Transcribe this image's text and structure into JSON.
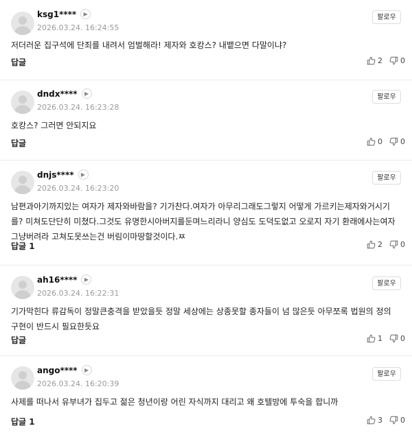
{
  "follow_label": "팔로우",
  "reply_label": "답글",
  "comments": [
    {
      "nickname": "ksg1****",
      "date": "2026.03.24. 16:24:55",
      "text": "저더러운 집구석에 단죄를 내려서 엄벌해라! 제자와 호캉스? 내뱉으면 다말이냐?",
      "reply": "답글",
      "likes": "2",
      "dislikes": "0"
    },
    {
      "nickname": "dndx****",
      "date": "2026.03.24. 16:23:28",
      "text": "호캉스? 그러면 안되지요",
      "reply": "답글",
      "likes": "0",
      "dislikes": "0"
    },
    {
      "nickname": "dnjs****",
      "date": "2026.03.24. 16:23:20",
      "text": "남편과아기까지있는 여자가 제자와바람을? 기가찬다.여자가 아무리그래도그렇지 어떻게 가르키는제자와거시기를? 미쳐도단단히 미쳤다.그것도 유명한시아버지를둔며느리라니 양심도 도덕도없고 오로지 자기 환래에사는여자 그냥버려라 고쳐도못쓰는건 버림이마땅할것이다.ㅉ",
      "reply": "답글 1",
      "likes": "2",
      "dislikes": "0"
    },
    {
      "nickname": "ah16****",
      "date": "2026.03.24. 16:22:31",
      "text": "기가막힌다 류감독이 정말큰충격을 받았을듯 정말 세상에는 상종못할 종자들이 넘 많은듯 아무쪼록 법원의 정의구현이 반드시 필요한듯요",
      "reply": "답글",
      "likes": "1",
      "dislikes": "0"
    },
    {
      "nickname": "ango****",
      "date": "2026.03.24. 16:20:39",
      "text": "사제를 떠나서 유부녀가 집두고 젊은 청년이랑 어린 자식까지 대리고 왜 호텔방에 투숙을 합니까",
      "reply": "답글 1",
      "likes": "3",
      "dislikes": "0"
    }
  ],
  "icons": {
    "profile": "chevron-right-icon",
    "like": "thumbs-up-icon",
    "dislike": "thumbs-down-icon"
  }
}
